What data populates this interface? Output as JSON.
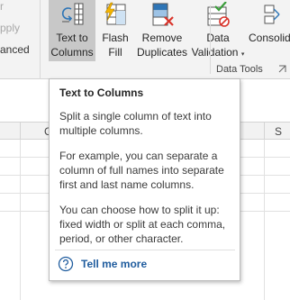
{
  "ribbon": {
    "left_items": [
      "r",
      "pply",
      "anced"
    ],
    "buttons": [
      {
        "id": "text-to-columns",
        "label1": "Text to",
        "label2": "Columns",
        "icon": "text-to-columns-icon"
      },
      {
        "id": "flash-fill",
        "label1": "Flash",
        "label2": "Fill",
        "icon": "flash-fill-icon"
      },
      {
        "id": "remove-duplicates",
        "label1": "Remove",
        "label2": "Duplicates",
        "icon": "remove-duplicates-icon"
      },
      {
        "id": "data-validation",
        "label1": "Data",
        "label2": "Validation",
        "dropdown_arrow": "▾",
        "icon": "data-validation-icon"
      },
      {
        "id": "consolidate",
        "label1": "Consolid",
        "label2": "",
        "icon": "consolidate-icon"
      }
    ],
    "group_label": "Data Tools"
  },
  "sheet": {
    "columns": [
      "C",
      "S"
    ]
  },
  "tooltip": {
    "title": "Text to Columns",
    "p1": "Split a single column of text into multiple columns.",
    "p2": "For example, you can separate a column of full names into separate first and last name columns.",
    "p3": "You can choose how to split it up: fixed width or split at each comma, period, or other character.",
    "help_link": "Tell me more",
    "help_icon": "question-circle-icon"
  },
  "colors": {
    "ribbon_bg": "#f3f3f3",
    "active_button_bg": "#c8c8c8",
    "link_blue": "#1f5c9e",
    "icon_blue": "#2e75b6",
    "icon_red": "#d9342b",
    "icon_yellow": "#f4b400",
    "icon_green": "#3a9d3a"
  }
}
